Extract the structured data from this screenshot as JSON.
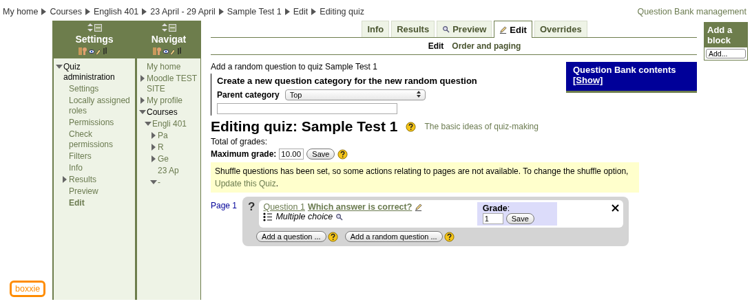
{
  "breadcrumb": [
    "My home",
    "Courses",
    "English 401",
    "23 April - 29 April",
    "Sample Test 1",
    "Edit",
    "Editing quiz"
  ],
  "header_link": "Question Bank management",
  "settings_block": {
    "title": "Settings",
    "items": [
      {
        "label": "Quiz administration",
        "expanded": true,
        "children": [
          {
            "label": "Settings",
            "selected": false
          },
          {
            "label": "Locally assigned roles",
            "selected": false
          },
          {
            "label": "Permissions",
            "selected": false
          },
          {
            "label": "Check permissions",
            "selected": false
          },
          {
            "label": "Filters",
            "selected": false
          },
          {
            "label": "Info",
            "selected": false
          },
          {
            "label": "Results",
            "selected": false,
            "expanded": false
          },
          {
            "label": "Preview",
            "selected": false
          },
          {
            "label": "Edit",
            "selected": true
          }
        ]
      }
    ]
  },
  "navigation_block": {
    "title": "Navigat",
    "items": [
      {
        "label": "My home"
      },
      {
        "label": "Moodle TEST SITE",
        "expanded": false
      },
      {
        "label": "My profile",
        "expanded": false
      },
      {
        "label": "Courses",
        "expanded": true,
        "children": [
          {
            "label": "Engli 401",
            "expanded": true,
            "children": [
              {
                "label": "Pa",
                "expanded": false
              },
              {
                "label": "R",
                "expanded": false
              },
              {
                "label": "Ge",
                "expanded": false
              },
              {
                "label": "23 Ap"
              },
              {
                "label": "-",
                "expanded": true
              }
            ]
          }
        ]
      }
    ]
  },
  "tabs": [
    {
      "label": "Info",
      "kind": "plain",
      "selected": false
    },
    {
      "label": "Results",
      "kind": "plain",
      "selected": false
    },
    {
      "label": "Preview",
      "kind": "preview",
      "selected": false
    },
    {
      "label": "Edit",
      "kind": "edit",
      "selected": true
    },
    {
      "label": "Overrides",
      "kind": "plain",
      "selected": false
    }
  ],
  "subtabs": [
    {
      "label": "Edit",
      "selected": true
    },
    {
      "label": "Order and paging",
      "selected": false
    }
  ],
  "random_question": {
    "intro": "Add a random question to quiz Sample Test 1",
    "heading": "Create a new question category for the new random question",
    "parent_label": "Parent category",
    "parent_value": "Top"
  },
  "question_bank": {
    "title": "Question Bank contents",
    "show_link": "[Show]"
  },
  "heading": "Editing quiz: Sample Test 1",
  "help_link": "The basic ideas of quiz-making",
  "total_grades": "Total of grades:",
  "max_grade": {
    "label": "Maximum grade:",
    "value": "10.00",
    "button": "Save"
  },
  "notice": {
    "text": "Shuffle questions has been set, so some actions relating to pages are not available. To change the shuffle option,",
    "link": "Update this Quiz",
    "end": "."
  },
  "page_label": "Page 1",
  "question": {
    "marker": "?",
    "number": "Question 1",
    "title": "Which answer is correct?",
    "type": "Multiple choice",
    "grade_label": "**Grade**:",
    "grade_value": "1",
    "save": "Save"
  },
  "add_buttons": [
    "Add a question ...",
    "Add a random question ..."
  ],
  "add_block": {
    "title": "Add a block",
    "button": "Add..."
  },
  "badge": "boxxie"
}
